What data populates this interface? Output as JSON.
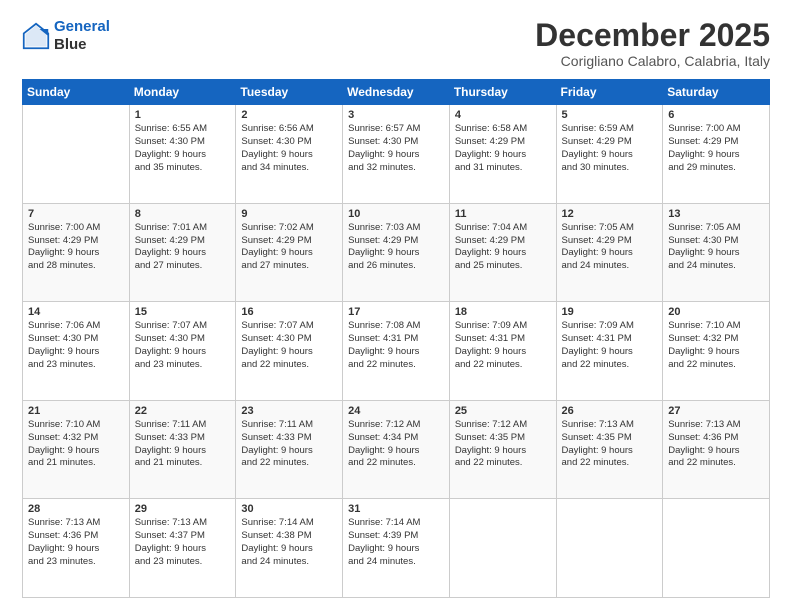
{
  "logo": {
    "line1": "General",
    "line2": "Blue"
  },
  "header": {
    "title": "December 2025",
    "subtitle": "Corigliano Calabro, Calabria, Italy"
  },
  "weekdays": [
    "Sunday",
    "Monday",
    "Tuesday",
    "Wednesday",
    "Thursday",
    "Friday",
    "Saturday"
  ],
  "weeks": [
    [
      {
        "day": "",
        "info": ""
      },
      {
        "day": "1",
        "info": "Sunrise: 6:55 AM\nSunset: 4:30 PM\nDaylight: 9 hours\nand 35 minutes."
      },
      {
        "day": "2",
        "info": "Sunrise: 6:56 AM\nSunset: 4:30 PM\nDaylight: 9 hours\nand 34 minutes."
      },
      {
        "day": "3",
        "info": "Sunrise: 6:57 AM\nSunset: 4:30 PM\nDaylight: 9 hours\nand 32 minutes."
      },
      {
        "day": "4",
        "info": "Sunrise: 6:58 AM\nSunset: 4:29 PM\nDaylight: 9 hours\nand 31 minutes."
      },
      {
        "day": "5",
        "info": "Sunrise: 6:59 AM\nSunset: 4:29 PM\nDaylight: 9 hours\nand 30 minutes."
      },
      {
        "day": "6",
        "info": "Sunrise: 7:00 AM\nSunset: 4:29 PM\nDaylight: 9 hours\nand 29 minutes."
      }
    ],
    [
      {
        "day": "7",
        "info": "Sunrise: 7:00 AM\nSunset: 4:29 PM\nDaylight: 9 hours\nand 28 minutes."
      },
      {
        "day": "8",
        "info": "Sunrise: 7:01 AM\nSunset: 4:29 PM\nDaylight: 9 hours\nand 27 minutes."
      },
      {
        "day": "9",
        "info": "Sunrise: 7:02 AM\nSunset: 4:29 PM\nDaylight: 9 hours\nand 27 minutes."
      },
      {
        "day": "10",
        "info": "Sunrise: 7:03 AM\nSunset: 4:29 PM\nDaylight: 9 hours\nand 26 minutes."
      },
      {
        "day": "11",
        "info": "Sunrise: 7:04 AM\nSunset: 4:29 PM\nDaylight: 9 hours\nand 25 minutes."
      },
      {
        "day": "12",
        "info": "Sunrise: 7:05 AM\nSunset: 4:29 PM\nDaylight: 9 hours\nand 24 minutes."
      },
      {
        "day": "13",
        "info": "Sunrise: 7:05 AM\nSunset: 4:30 PM\nDaylight: 9 hours\nand 24 minutes."
      }
    ],
    [
      {
        "day": "14",
        "info": "Sunrise: 7:06 AM\nSunset: 4:30 PM\nDaylight: 9 hours\nand 23 minutes."
      },
      {
        "day": "15",
        "info": "Sunrise: 7:07 AM\nSunset: 4:30 PM\nDaylight: 9 hours\nand 23 minutes."
      },
      {
        "day": "16",
        "info": "Sunrise: 7:07 AM\nSunset: 4:30 PM\nDaylight: 9 hours\nand 22 minutes."
      },
      {
        "day": "17",
        "info": "Sunrise: 7:08 AM\nSunset: 4:31 PM\nDaylight: 9 hours\nand 22 minutes."
      },
      {
        "day": "18",
        "info": "Sunrise: 7:09 AM\nSunset: 4:31 PM\nDaylight: 9 hours\nand 22 minutes."
      },
      {
        "day": "19",
        "info": "Sunrise: 7:09 AM\nSunset: 4:31 PM\nDaylight: 9 hours\nand 22 minutes."
      },
      {
        "day": "20",
        "info": "Sunrise: 7:10 AM\nSunset: 4:32 PM\nDaylight: 9 hours\nand 22 minutes."
      }
    ],
    [
      {
        "day": "21",
        "info": "Sunrise: 7:10 AM\nSunset: 4:32 PM\nDaylight: 9 hours\nand 21 minutes."
      },
      {
        "day": "22",
        "info": "Sunrise: 7:11 AM\nSunset: 4:33 PM\nDaylight: 9 hours\nand 21 minutes."
      },
      {
        "day": "23",
        "info": "Sunrise: 7:11 AM\nSunset: 4:33 PM\nDaylight: 9 hours\nand 22 minutes."
      },
      {
        "day": "24",
        "info": "Sunrise: 7:12 AM\nSunset: 4:34 PM\nDaylight: 9 hours\nand 22 minutes."
      },
      {
        "day": "25",
        "info": "Sunrise: 7:12 AM\nSunset: 4:35 PM\nDaylight: 9 hours\nand 22 minutes."
      },
      {
        "day": "26",
        "info": "Sunrise: 7:13 AM\nSunset: 4:35 PM\nDaylight: 9 hours\nand 22 minutes."
      },
      {
        "day": "27",
        "info": "Sunrise: 7:13 AM\nSunset: 4:36 PM\nDaylight: 9 hours\nand 22 minutes."
      }
    ],
    [
      {
        "day": "28",
        "info": "Sunrise: 7:13 AM\nSunset: 4:36 PM\nDaylight: 9 hours\nand 23 minutes."
      },
      {
        "day": "29",
        "info": "Sunrise: 7:13 AM\nSunset: 4:37 PM\nDaylight: 9 hours\nand 23 minutes."
      },
      {
        "day": "30",
        "info": "Sunrise: 7:14 AM\nSunset: 4:38 PM\nDaylight: 9 hours\nand 24 minutes."
      },
      {
        "day": "31",
        "info": "Sunrise: 7:14 AM\nSunset: 4:39 PM\nDaylight: 9 hours\nand 24 minutes."
      },
      {
        "day": "",
        "info": ""
      },
      {
        "day": "",
        "info": ""
      },
      {
        "day": "",
        "info": ""
      }
    ]
  ]
}
